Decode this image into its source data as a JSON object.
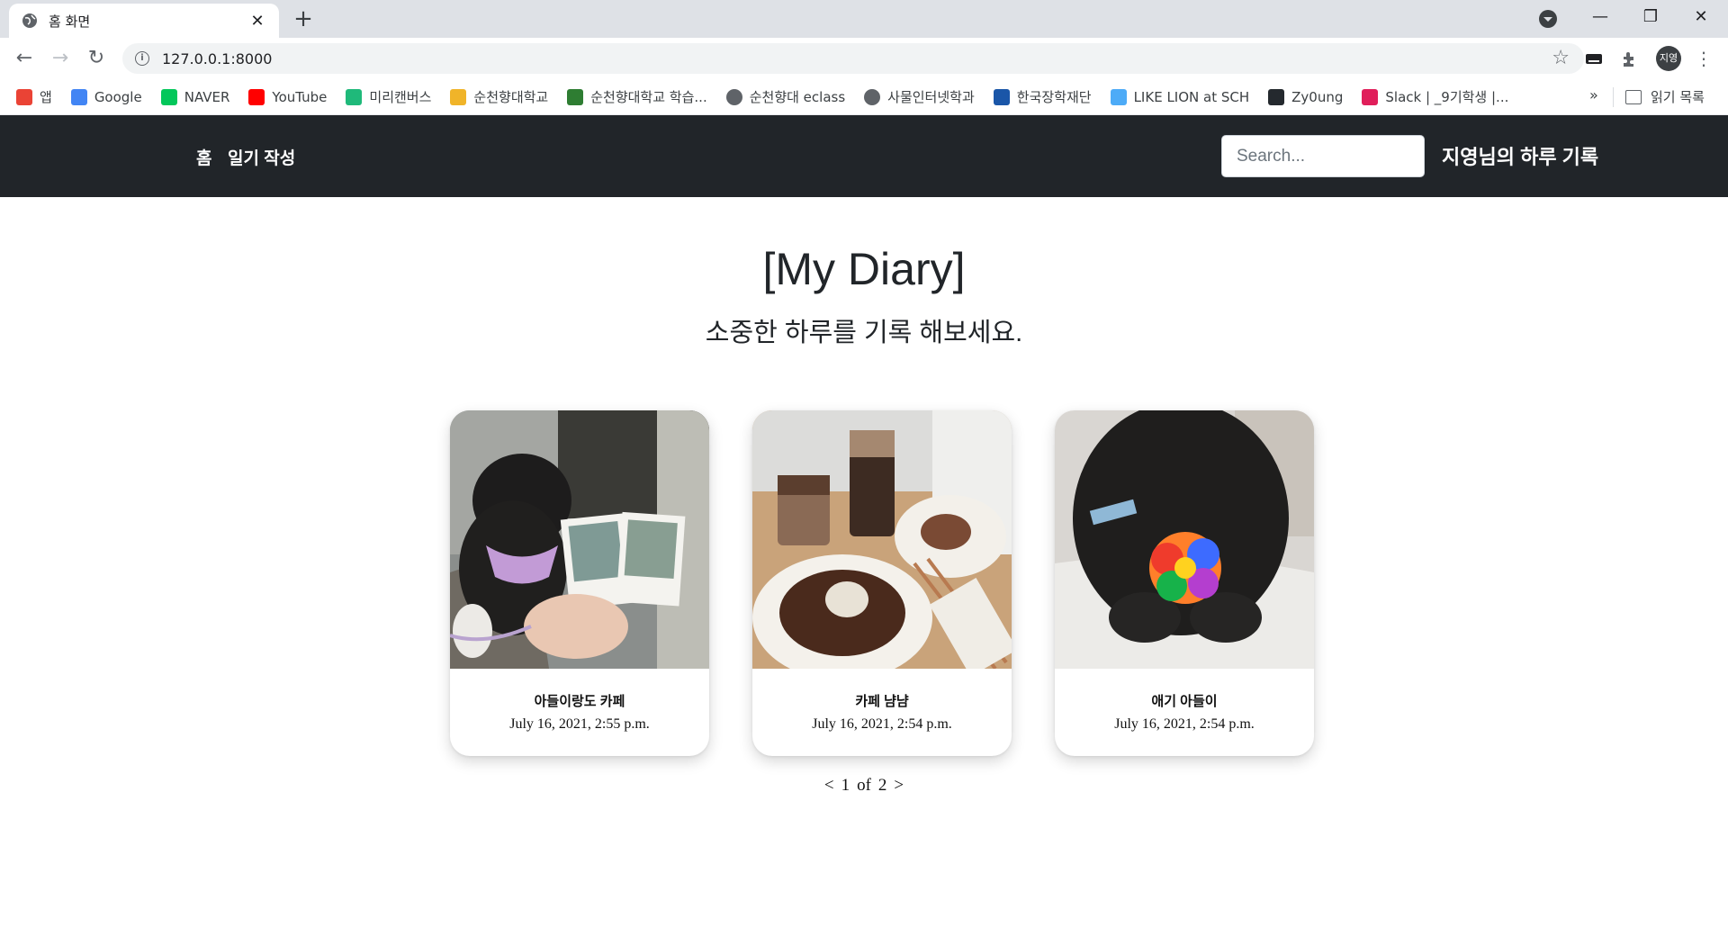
{
  "browser": {
    "tab_title": "홈 화면",
    "url": "127.0.0.1:8000",
    "profile_initials": "지영",
    "bookmarks": [
      {
        "label": "앱",
        "icon": "apps-grid-icon",
        "color": "#ea4335"
      },
      {
        "label": "Google",
        "icon": "google-icon",
        "color": "#4285f4"
      },
      {
        "label": "NAVER",
        "icon": "naver-icon",
        "color": "#03c75a"
      },
      {
        "label": "YouTube",
        "icon": "youtube-icon",
        "color": "#ff0000"
      },
      {
        "label": "미리캔버스",
        "icon": "miricanvas-icon",
        "color": "#1fb97a"
      },
      {
        "label": "순천향대학교",
        "icon": "sch-icon",
        "color": "#f0b429"
      },
      {
        "label": "순천향대학교 학습...",
        "icon": "sch-learning-icon",
        "color": "#2e7d32"
      },
      {
        "label": "순천향대 eclass",
        "icon": "globe-icon",
        "color": "#5f6368"
      },
      {
        "label": "사물인터넷학과",
        "icon": "globe-icon",
        "color": "#5f6368"
      },
      {
        "label": "한국장학재단",
        "icon": "scholarship-icon",
        "color": "#1a56a8"
      },
      {
        "label": "LIKE LION at SCH",
        "icon": "likelion-icon",
        "color": "#4dabf7"
      },
      {
        "label": "Zy0ung",
        "icon": "github-icon",
        "color": "#24292e"
      },
      {
        "label": "Slack | _9기학생 |...",
        "icon": "slack-icon",
        "color": "#e01e5a"
      }
    ],
    "more_label": "»",
    "reading_list_label": "읽기 목록"
  },
  "site": {
    "nav": {
      "home_label": "홈",
      "write_label": "일기 작성",
      "search_placeholder": "Search...",
      "brand": "지영님의 하루 기록"
    },
    "hero": {
      "title": "[My Diary]",
      "subtitle": "소중한 하루를 기록 해보세요."
    },
    "posts": [
      {
        "title": "아들이랑도 카페",
        "date": "July 16, 2021, 2:55 p.m."
      },
      {
        "title": "카페 냠냠",
        "date": "July 16, 2021, 2:54 p.m."
      },
      {
        "title": "애기 아들이",
        "date": "July 16, 2021, 2:54 p.m."
      }
    ],
    "pagination": {
      "prev": "<",
      "current": "1",
      "of": "of",
      "total": "2",
      "next": ">"
    }
  }
}
